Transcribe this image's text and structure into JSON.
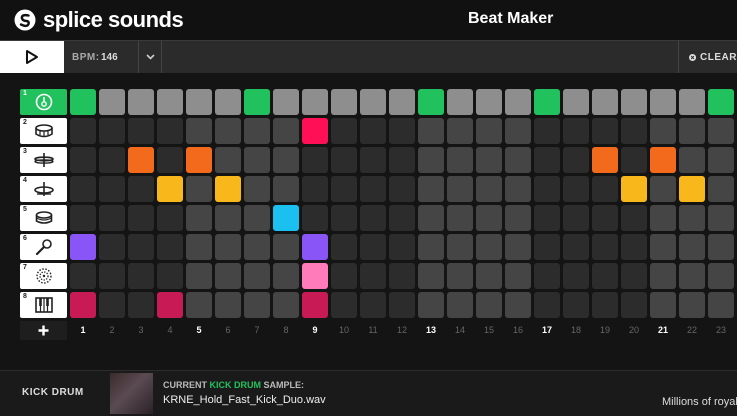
{
  "app": {
    "brand": "splice sounds",
    "title": "Beat Maker"
  },
  "toolbar": {
    "bpm_label": "BPM:",
    "bpm_value": "146",
    "clear_label": "CLEAR"
  },
  "instruments": [
    {
      "num": "1",
      "icon": "kick-icon",
      "active": true
    },
    {
      "num": "2",
      "icon": "snare-icon",
      "active": false
    },
    {
      "num": "3",
      "icon": "hihat-icon",
      "active": false
    },
    {
      "num": "4",
      "icon": "cymbal-icon",
      "active": false
    },
    {
      "num": "5",
      "icon": "tom-icon",
      "active": false
    },
    {
      "num": "6",
      "icon": "microphone-icon",
      "active": false
    },
    {
      "num": "7",
      "icon": "shaker-icon",
      "active": false
    },
    {
      "num": "8",
      "icon": "keys-icon",
      "active": false
    }
  ],
  "steps": [
    "1",
    "2",
    "3",
    "4",
    "5",
    "6",
    "7",
    "8",
    "9",
    "10",
    "11",
    "12",
    "13",
    "14",
    "15",
    "16",
    "17",
    "18",
    "19",
    "20",
    "21",
    "22",
    "23"
  ],
  "pattern": {
    "colors": {
      "kick": "#21c25e",
      "snare": "#ff0f55",
      "hihat": "#f46a1c",
      "cymbal": "#f8b81c",
      "tom": "#1bc0f0",
      "vocal": "#8a55f7",
      "shaker": "#ff7bb9",
      "keys": "#c81b55"
    },
    "active": [
      {
        "row": 0,
        "steps": [
          1,
          7,
          13,
          17,
          23
        ],
        "color": "kick"
      },
      {
        "row": 1,
        "steps": [
          9
        ],
        "color": "snare"
      },
      {
        "row": 2,
        "steps": [
          3,
          5,
          19,
          21
        ],
        "color": "hihat"
      },
      {
        "row": 3,
        "steps": [
          4,
          6,
          20,
          22
        ],
        "color": "cymbal"
      },
      {
        "row": 4,
        "steps": [
          8
        ],
        "color": "tom"
      },
      {
        "row": 5,
        "steps": [
          1,
          9
        ],
        "color": "vocal"
      },
      {
        "row": 6,
        "steps": [
          9
        ],
        "color": "shaker"
      },
      {
        "row": 7,
        "steps": [
          1,
          4,
          9
        ],
        "color": "keys"
      }
    ]
  },
  "footer": {
    "instrument": "KICK DRUM",
    "sample_prefix": "CURRENT ",
    "sample_highlight": "KICK DRUM",
    "sample_suffix": " SAMPLE:",
    "sample_name": "KRNE_Hold_Fast_Kick_Duo.wav",
    "promo": "Millions of royal"
  }
}
